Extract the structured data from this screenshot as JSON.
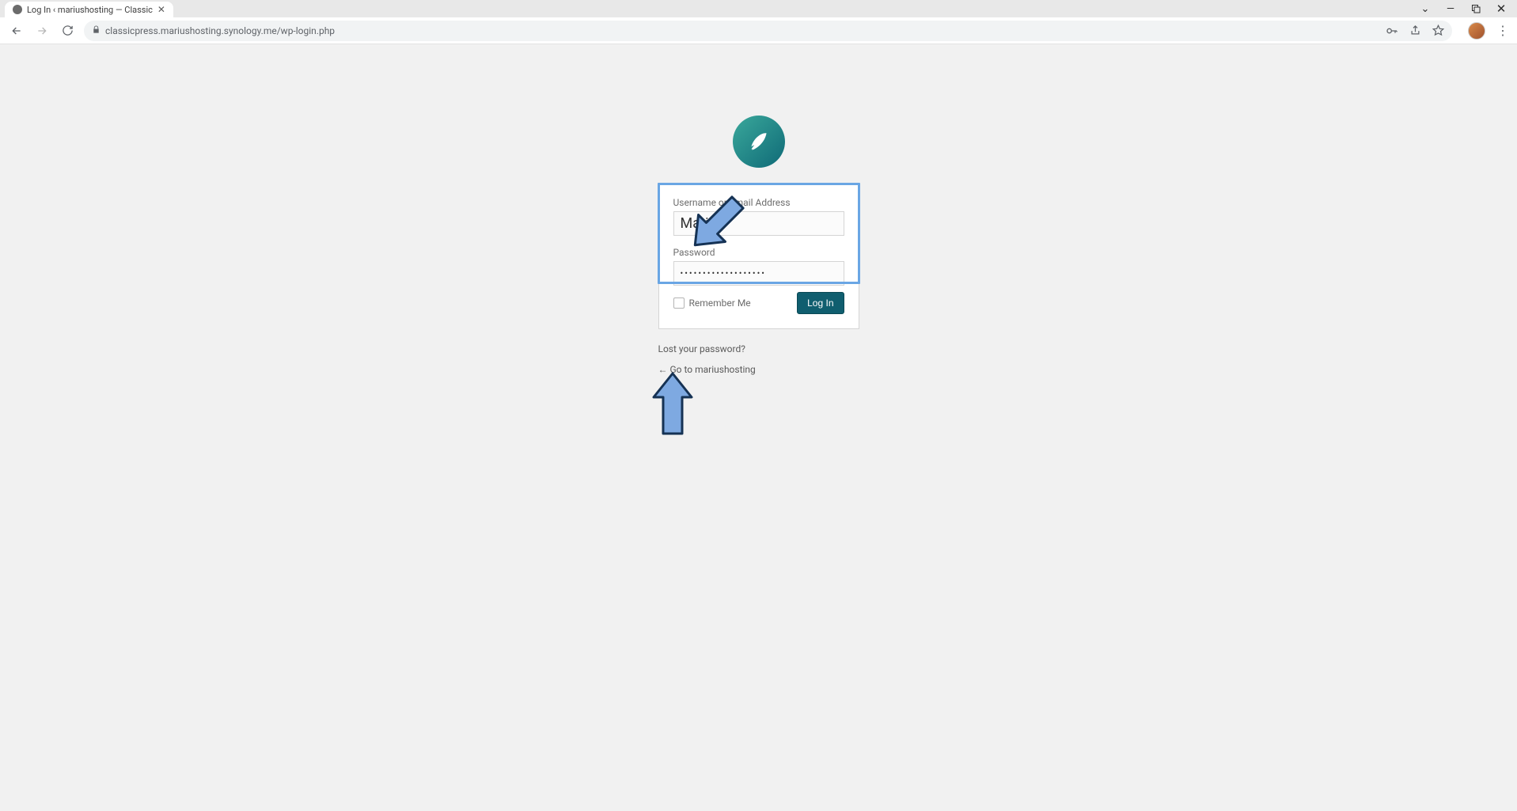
{
  "browser": {
    "tab_title": "Log In ‹ mariushosting — Classic",
    "url": "classicpress.mariushosting.synology.me/wp-login.php"
  },
  "login": {
    "username_label": "Username or Email Address",
    "username_value": "Marius",
    "password_label": "Password",
    "password_value": "•••••••••••••••••••",
    "remember_label": "Remember Me",
    "submit_label": "Log In"
  },
  "links": {
    "lost_password": "Lost your password?",
    "back_to_site": "← Go to mariushosting"
  }
}
